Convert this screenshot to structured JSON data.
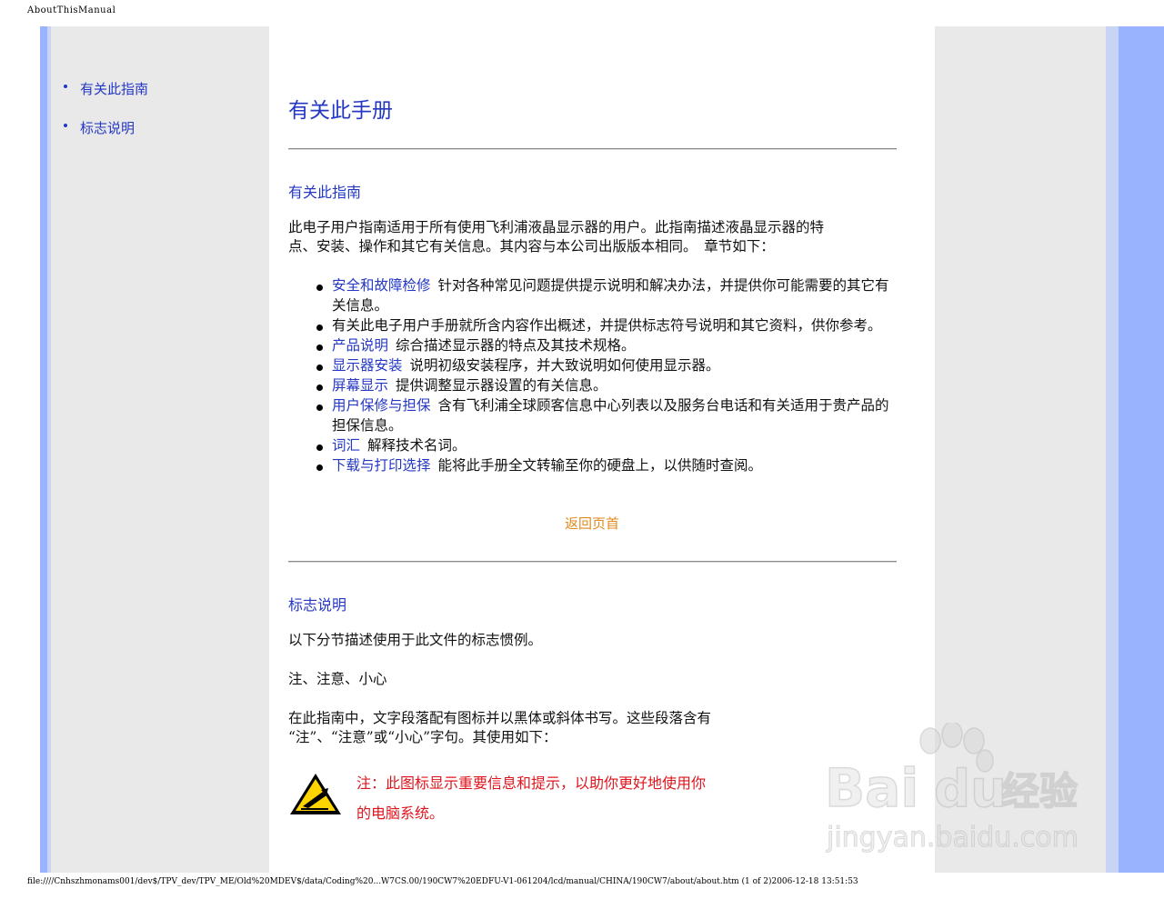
{
  "header": {
    "title": "AboutThisManual"
  },
  "footer": {
    "path": "file:////Cnhszhmonams001/dev$/TPV_dev/TPV_ME/Old%20MDEV$/data/Coding%20...W7CS.00/190CW7%20EDFU-V1-061204/lcd/manual/CHINA/190CW7/about/about.htm (1 of 2)2006-12-18 13:51:53"
  },
  "sidebar": {
    "items": [
      {
        "label": "有关此指南"
      },
      {
        "label": "标志说明"
      }
    ]
  },
  "main": {
    "title": "有关此手册",
    "about_guide": {
      "heading": "有关此指南",
      "intro_line1": "此电子用户指南适用于所有使用飞利浦液晶显示器的用户。此指南描述液晶显示器的特",
      "intro_line2": "点、安装、操作和其它有关信息。其内容与本公司出版版本相同。　章节如下：",
      "bullets": [
        {
          "link": "安全和故障检修",
          "text": "针对各种常见问题提供提示说明和解决办法，并提供你可能需要的其它有关信息。"
        },
        {
          "link": "",
          "text": "有关此电子用户手册就所含内容作出概述，并提供标志符号说明和其它资料，供你参考。"
        },
        {
          "link": "产品说明",
          "text": "综合描述显示器的特点及其技术规格。"
        },
        {
          "link": "显示器安装",
          "text": "说明初级安装程序，并大致说明如何使用显示器。"
        },
        {
          "link": "屏幕显示",
          "text": "提供调整显示器设置的有关信息。"
        },
        {
          "link": "用户保修与担保",
          "text": "含有飞利浦全球顾客信息中心列表以及服务台电话和有关适用于贵产品的担保信息。"
        },
        {
          "link": "词汇",
          "text": "解释技术名词。"
        },
        {
          "link": "下载与打印选择",
          "text": "能将此手册全文转输至你的硬盘上，以供随时查阅。"
        }
      ],
      "back_to_top": "返回页首"
    },
    "symbols": {
      "heading": "标志说明",
      "intro": "以下分节描述使用于此文件的标志惯例。",
      "subheading": "注、注意、小心",
      "desc_line1": "在此指南中，文字段落配有图标并以黑体或斜体书写。这些段落含有",
      "desc_line2": "“注”、“注意”或“小心”字句。其使用如下：",
      "note_line1": "注：此图标显示重要信息和提示，以助你更好地使用你",
      "note_line2": "的电脑系统。"
    }
  },
  "watermark": {
    "brand": "Bai",
    "brand_cn": "经验",
    "url": "jingyan.baidu.com"
  },
  "colors": {
    "link": "#2438c4",
    "accent_orange": "#e08a20",
    "note_red": "#e0141c",
    "stripe_blue": "#99b3ff"
  }
}
